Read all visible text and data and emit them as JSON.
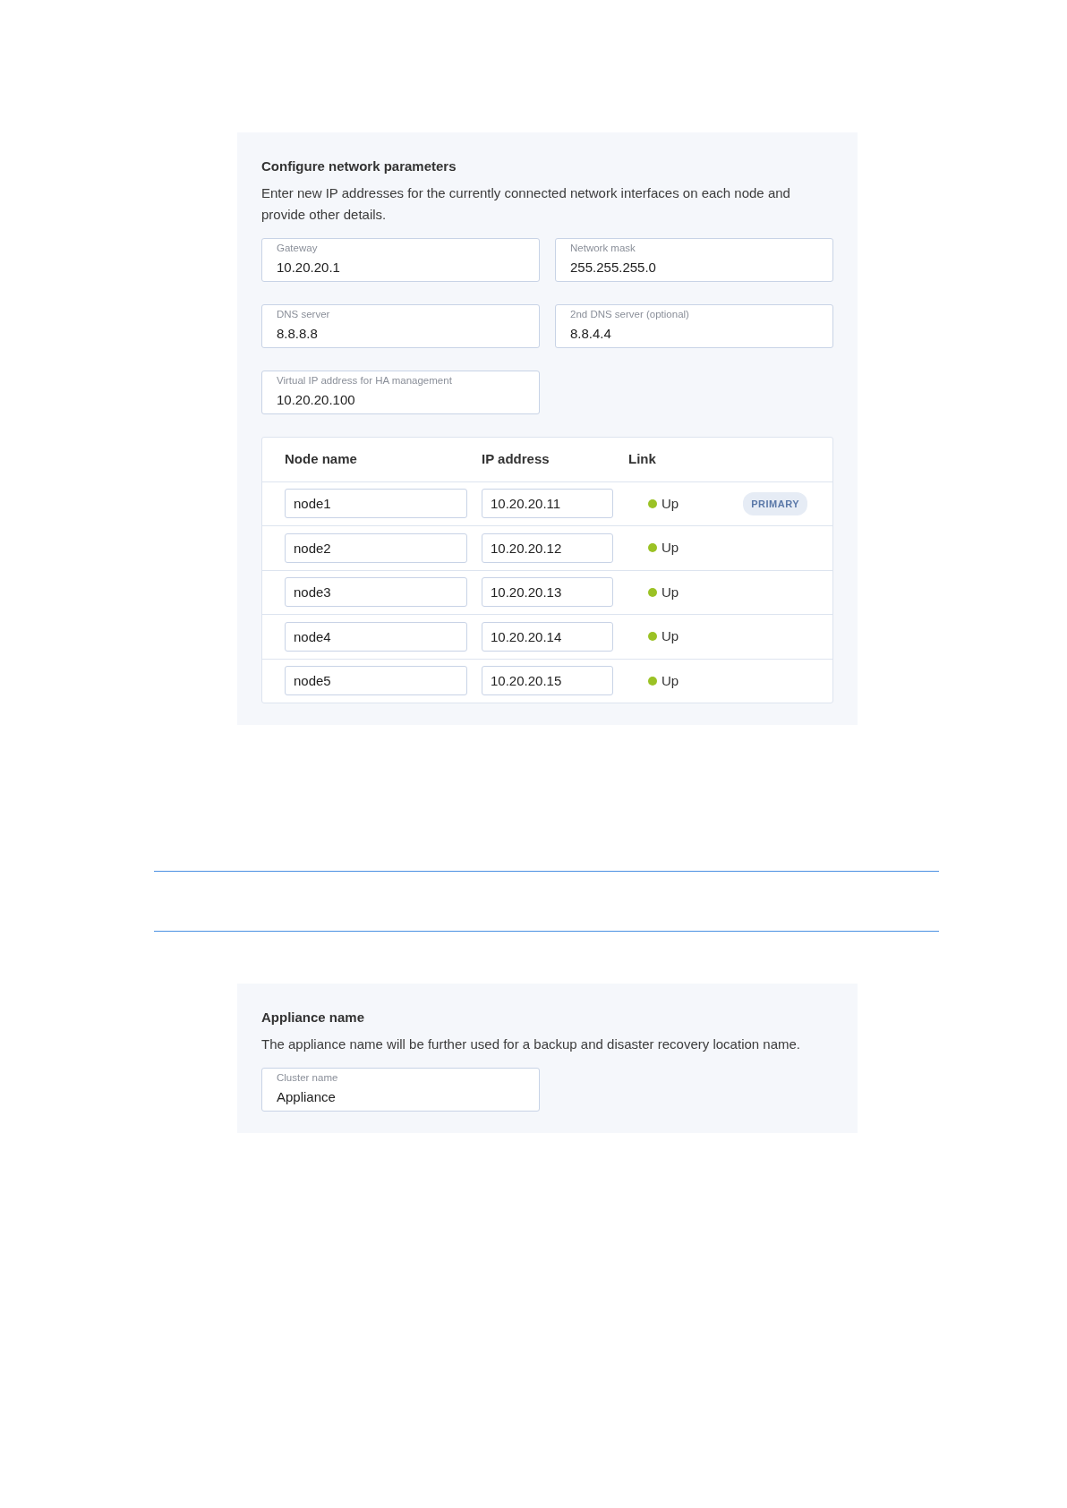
{
  "network_panel": {
    "title": "Configure network parameters",
    "description": "Enter new IP addresses for the currently connected network interfaces on each node and provide other details.",
    "fields": [
      {
        "label": "Gateway",
        "value": "10.20.20.1"
      },
      {
        "label": "Network mask",
        "value": "255.255.255.0"
      },
      {
        "label": "DNS server",
        "value": "8.8.8.8"
      },
      {
        "label": "2nd DNS server (optional)",
        "value": "8.8.4.4"
      },
      {
        "label": "Virtual IP address for HA management",
        "value": "10.20.20.100"
      }
    ],
    "table": {
      "columns": [
        "Node name",
        "IP address",
        "Link"
      ],
      "rows": [
        {
          "node_name": "node1",
          "ip_address": "10.20.20.11",
          "link": "Up",
          "color": "#9bc225",
          "badge": "PRIMARY"
        },
        {
          "node_name": "node2",
          "ip_address": "10.20.20.12",
          "link": "Up",
          "color": "#9bc225"
        },
        {
          "node_name": "node3",
          "ip_address": "10.20.20.13",
          "link": "Up",
          "color": "#9bc225"
        },
        {
          "node_name": "node4",
          "ip_address": "10.20.20.14",
          "link": "Up",
          "color": "#9bc225"
        },
        {
          "node_name": "node5",
          "ip_address": "10.20.20.15",
          "link": "Up",
          "color": "#9bc225"
        }
      ]
    }
  },
  "appliance_panel": {
    "title": "Appliance name",
    "description": "The appliance name will be further used for a backup and disaster recovery location name.",
    "fields": [
      {
        "label": "Cluster name",
        "value": "Appliance"
      }
    ]
  }
}
